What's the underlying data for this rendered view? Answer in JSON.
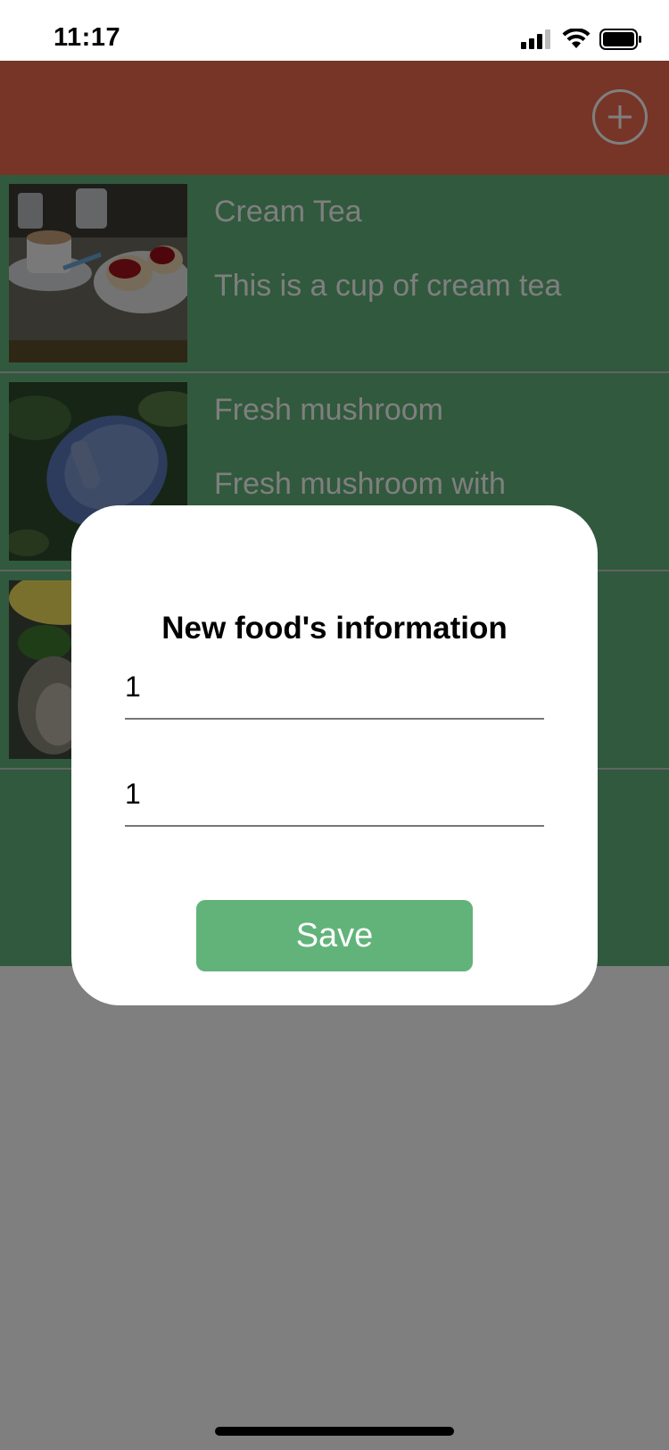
{
  "status_bar": {
    "time": "11:17",
    "icons": [
      "signal-icon",
      "wifi-icon",
      "battery-icon"
    ]
  },
  "app_bar": {
    "color": "#ef6b4f",
    "add_icon": "plus-circle-icon"
  },
  "food_list": {
    "background": "#62b37a",
    "items": [
      {
        "title": "Cream Tea",
        "description": "This is a cup of cream tea",
        "image": "cream-tea-photo"
      },
      {
        "title": "Fresh mushroom",
        "description": "Fresh mushroom with",
        "image": "mushroom-photo"
      },
      {
        "title": "",
        "description": "",
        "image": "fish-lemon-photo"
      }
    ]
  },
  "dialog": {
    "title": "New food's information",
    "field_name_value": "1",
    "field_description_value": "1",
    "save_label": "Save",
    "save_color": "#62b37a"
  }
}
